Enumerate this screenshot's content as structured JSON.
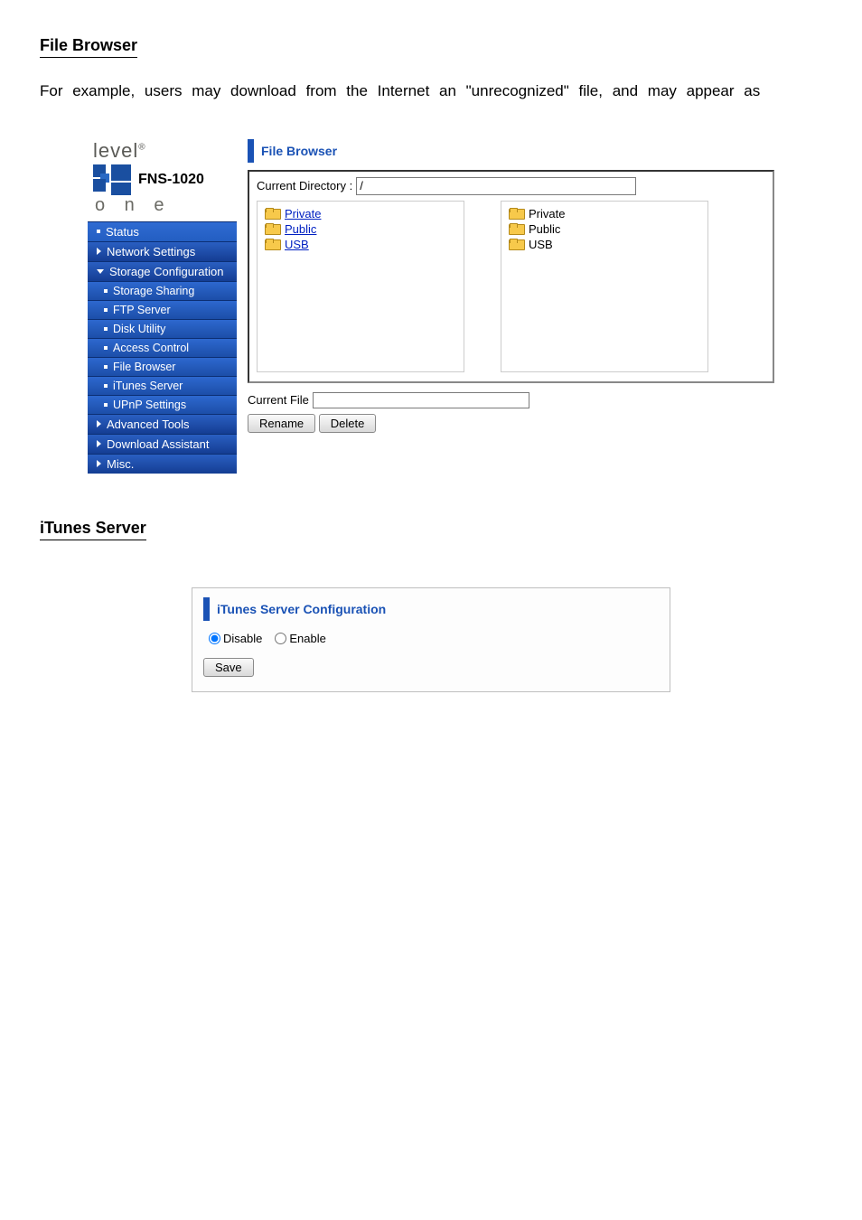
{
  "doc": {
    "section_file_browser_heading": "File Browser",
    "para_intro": "For example, users may download from the Internet an \"unrecognized\" file, and may appear as",
    "section_itunes_heading": "iTunes Server"
  },
  "logo": {
    "brand_top": "level",
    "brand_reg": "®",
    "model": "FNS-1020",
    "brand_bottom": "o n e"
  },
  "nav": {
    "status": "Status",
    "network": "Network Settings",
    "storage": "Storage Configuration",
    "storage_sharing": "Storage Sharing",
    "ftp": "FTP Server",
    "disk": "Disk Utility",
    "access": "Access Control",
    "filebrowser": "File Browser",
    "itunes": "iTunes Server",
    "upnp": "UPnP Settings",
    "advanced": "Advanced Tools",
    "download": "Download Assistant",
    "misc": "Misc."
  },
  "fb_panel": {
    "title": "File Browser",
    "curdir_label": "Current Directory :",
    "curdir_value": "/",
    "left_links": [
      "Private",
      "Public",
      "USB"
    ],
    "right_labels": [
      "Private",
      "Public",
      "USB"
    ],
    "current_file_label": "Current File",
    "current_file_value": "",
    "btn_rename": "Rename",
    "btn_delete": "Delete"
  },
  "itunes_panel": {
    "title": "iTunes Server Configuration",
    "opt_disable": "Disable",
    "opt_enable": "Enable",
    "btn_save": "Save",
    "selected": "disable"
  }
}
